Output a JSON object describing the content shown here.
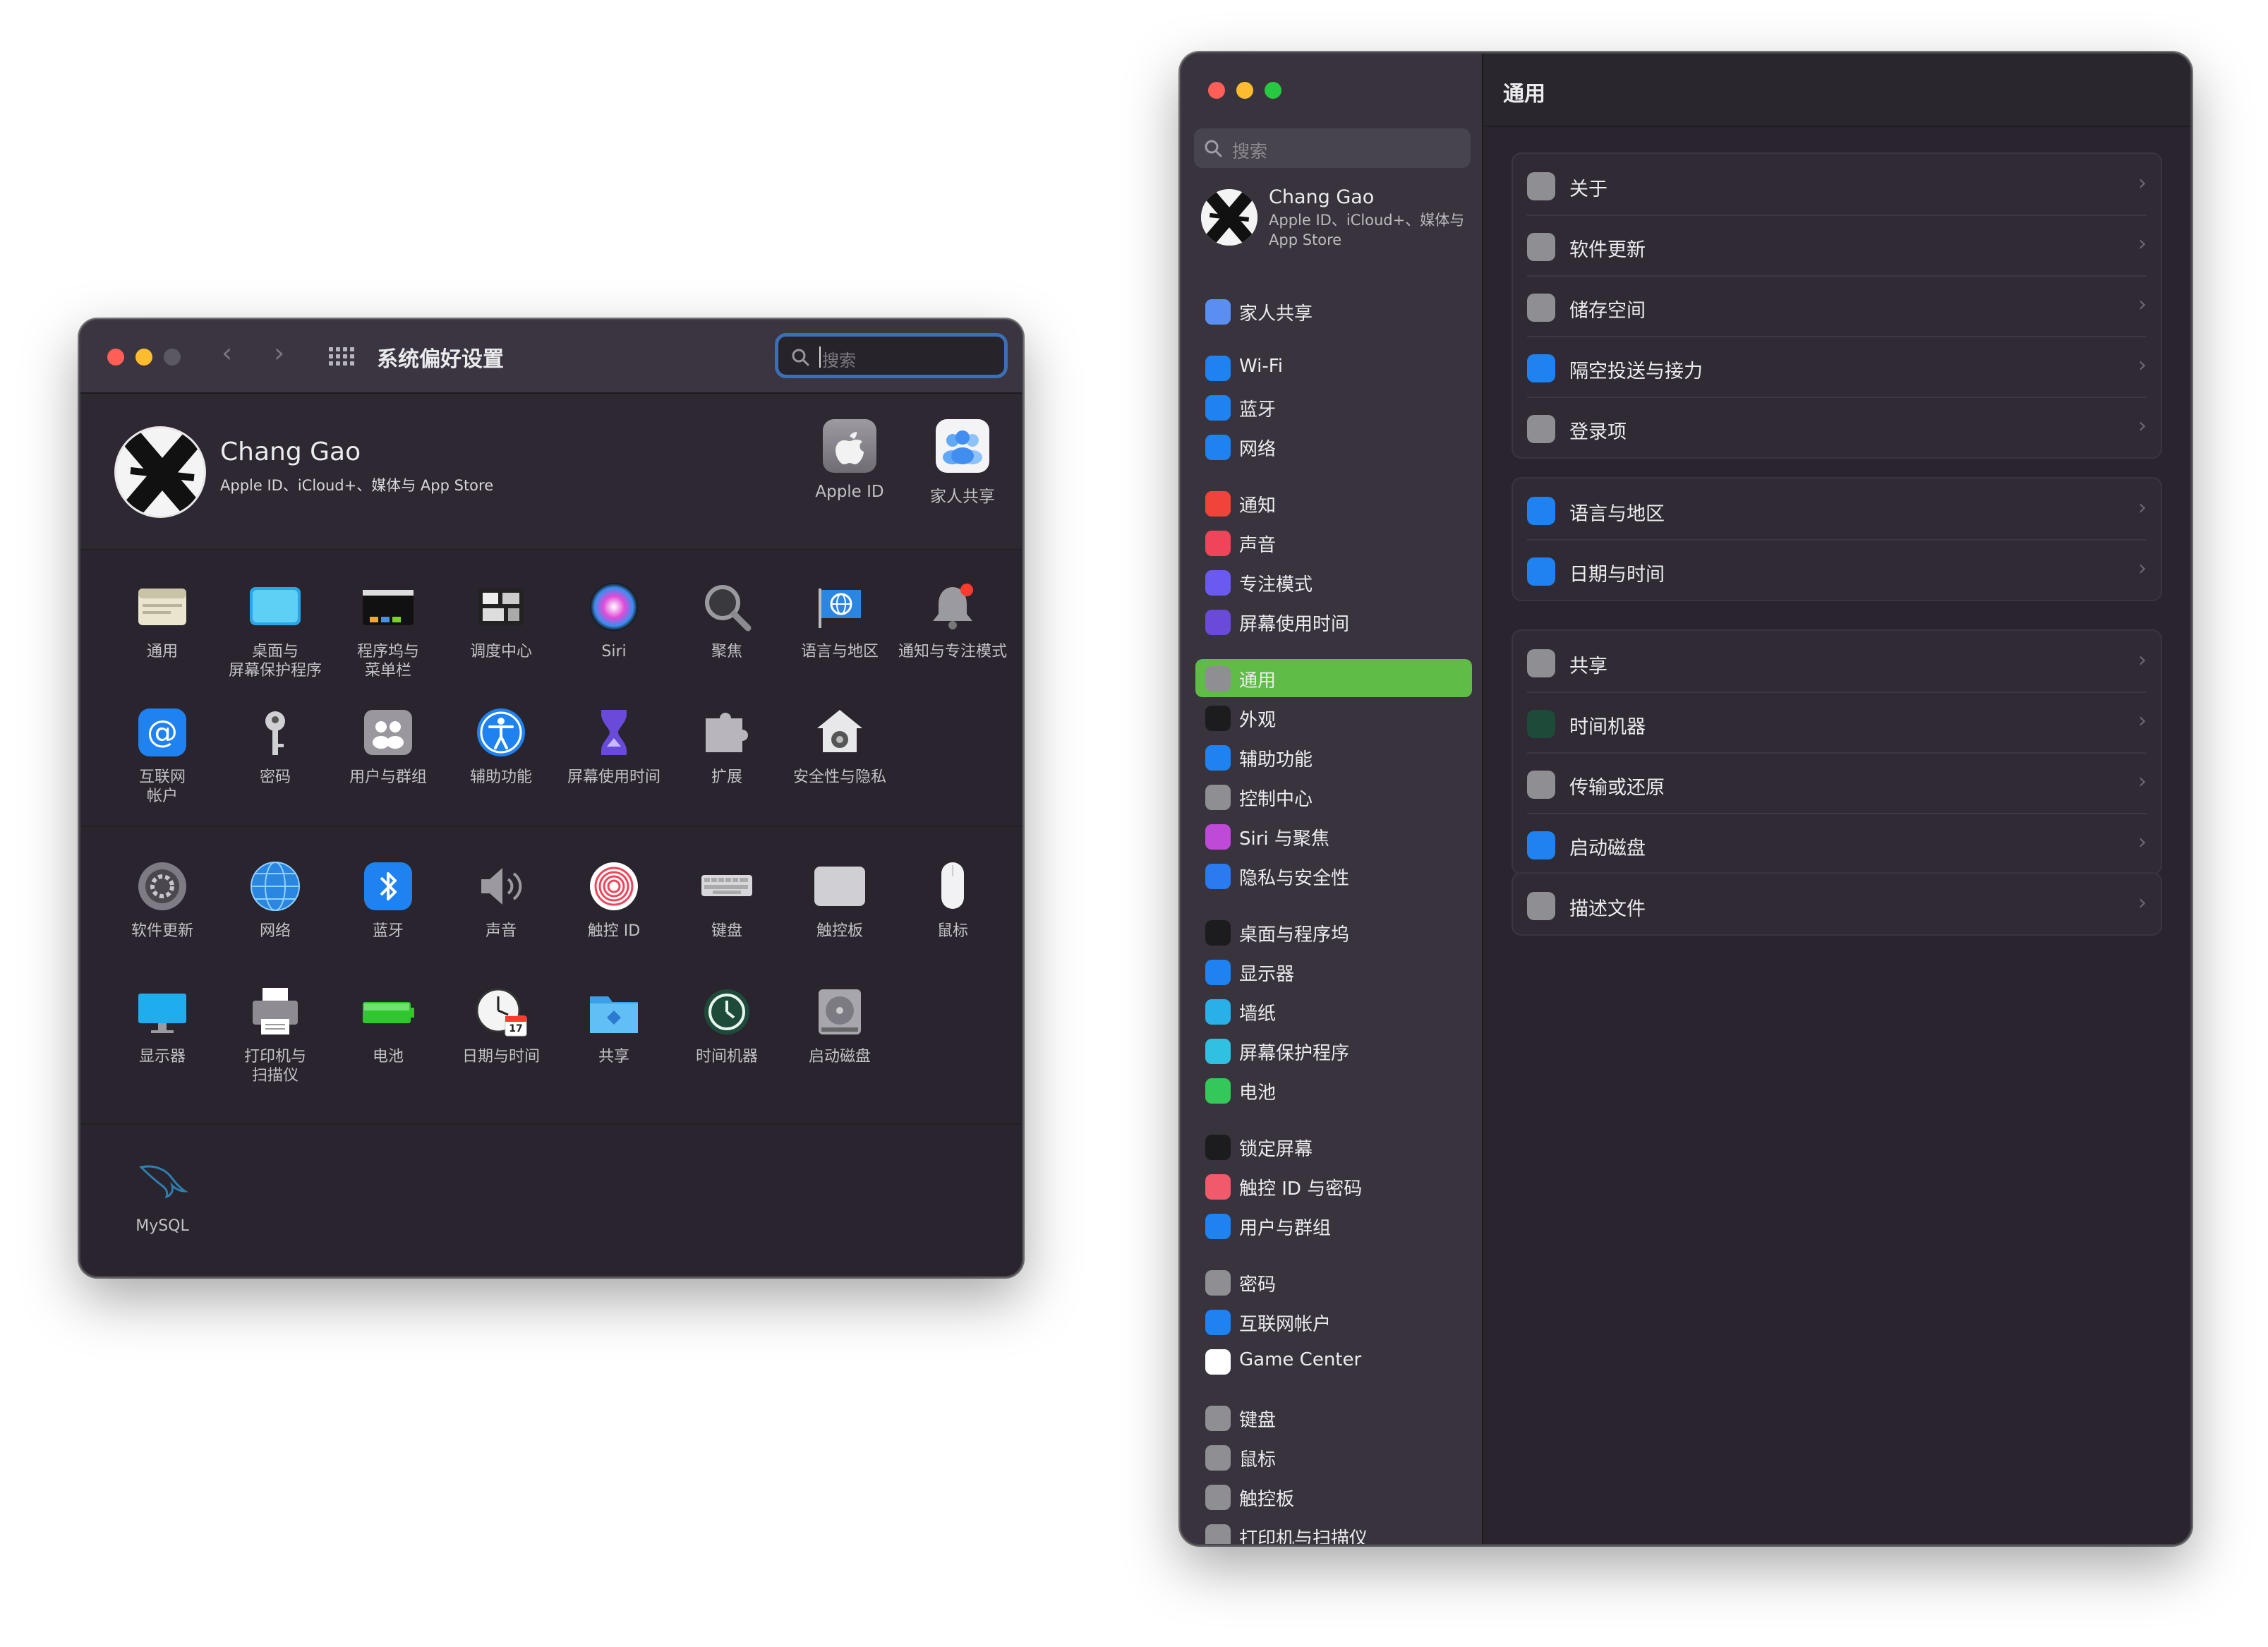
{
  "colors": {
    "accent_green": "#5fbc47",
    "search_focus_blue": "#3b6fb6",
    "traffic_red": "#ff5f57",
    "traffic_yellow": "#febc2e",
    "traffic_green": "#28c840",
    "window_bg": "#29242e"
  },
  "left_window": {
    "title": "系统偏好设置",
    "search": {
      "placeholder": "搜索"
    },
    "user": {
      "name": "Chang Gao",
      "subtitle": "Apple ID、iCloud+、媒体与 App Store"
    },
    "top_apps": [
      {
        "label": "Apple ID",
        "icon": "apple-id-icon"
      },
      {
        "label": "家人共享",
        "icon": "family-sharing-icon"
      }
    ],
    "section1": [
      {
        "label": "通用",
        "icon": "general-icon"
      },
      {
        "label": "桌面与\n屏幕保护程序",
        "icon": "desktop-screensaver-icon"
      },
      {
        "label": "程序坞与\n菜单栏",
        "icon": "dock-menubar-icon"
      },
      {
        "label": "调度中心",
        "icon": "mission-control-icon"
      },
      {
        "label": "Siri",
        "icon": "siri-icon"
      },
      {
        "label": "聚焦",
        "icon": "spotlight-icon"
      },
      {
        "label": "语言与地区",
        "icon": "language-region-icon"
      },
      {
        "label": "通知与专注模式",
        "icon": "notifications-focus-icon"
      },
      {
        "label": "互联网\n帐户",
        "icon": "internet-accounts-icon"
      },
      {
        "label": "密码",
        "icon": "passwords-icon"
      },
      {
        "label": "用户与群组",
        "icon": "users-groups-icon"
      },
      {
        "label": "辅助功能",
        "icon": "accessibility-icon"
      },
      {
        "label": "屏幕使用时间",
        "icon": "screen-time-icon"
      },
      {
        "label": "扩展",
        "icon": "extensions-icon"
      },
      {
        "label": "安全性与隐私",
        "icon": "security-privacy-icon"
      }
    ],
    "section2": [
      {
        "label": "软件更新",
        "icon": "software-update-icon"
      },
      {
        "label": "网络",
        "icon": "network-icon"
      },
      {
        "label": "蓝牙",
        "icon": "bluetooth-icon"
      },
      {
        "label": "声音",
        "icon": "sound-icon"
      },
      {
        "label": "触控 ID",
        "icon": "touch-id-icon"
      },
      {
        "label": "键盘",
        "icon": "keyboard-icon"
      },
      {
        "label": "触控板",
        "icon": "trackpad-icon"
      },
      {
        "label": "鼠标",
        "icon": "mouse-icon"
      },
      {
        "label": "显示器",
        "icon": "displays-icon"
      },
      {
        "label": "打印机与\n扫描仪",
        "icon": "printers-scanners-icon"
      },
      {
        "label": "电池",
        "icon": "battery-icon"
      },
      {
        "label": "日期与时间",
        "icon": "date-time-icon"
      },
      {
        "label": "共享",
        "icon": "sharing-icon"
      },
      {
        "label": "时间机器",
        "icon": "time-machine-icon"
      },
      {
        "label": "启动磁盘",
        "icon": "startup-disk-icon"
      }
    ],
    "section3": [
      {
        "label": "MySQL",
        "icon": "mysql-icon"
      }
    ],
    "calendar_day": "17"
  },
  "right_window": {
    "search": {
      "placeholder": "搜索"
    },
    "user": {
      "name": "Chang Gao",
      "subtitle": "Apple ID、iCloud+、媒体与 App Store"
    },
    "title": "通用",
    "sidebar": [
      {
        "label": "家人共享",
        "icon": "family-sharing-icon",
        "color": "#5a8ef0"
      },
      {
        "label": "Wi-Fi",
        "icon": "wifi-icon",
        "color": "#1e82f0"
      },
      {
        "label": "蓝牙",
        "icon": "bluetooth-icon",
        "color": "#1e82f0"
      },
      {
        "label": "网络",
        "icon": "network-icon",
        "color": "#1e82f0"
      },
      {
        "label": "通知",
        "icon": "notifications-icon",
        "color": "#f0443a"
      },
      {
        "label": "声音",
        "icon": "sound-icon",
        "color": "#f0445a"
      },
      {
        "label": "专注模式",
        "icon": "focus-icon",
        "color": "#6a5af0"
      },
      {
        "label": "屏幕使用时间",
        "icon": "screen-time-icon",
        "color": "#6a4ad8"
      },
      {
        "label": "通用",
        "icon": "general-icon",
        "color": "#8e8e93"
      },
      {
        "label": "外观",
        "icon": "appearance-icon",
        "color": "#1c1c1e"
      },
      {
        "label": "辅助功能",
        "icon": "accessibility-icon",
        "color": "#1e82f0"
      },
      {
        "label": "控制中心",
        "icon": "control-center-icon",
        "color": "#8e8e93"
      },
      {
        "label": "Siri 与聚焦",
        "icon": "siri-icon",
        "color": "#c04ad8"
      },
      {
        "label": "隐私与安全性",
        "icon": "privacy-security-icon",
        "color": "#2a7af0"
      },
      {
        "label": "桌面与程序坞",
        "icon": "desktop-dock-icon",
        "color": "#1c1c1e"
      },
      {
        "label": "显示器",
        "icon": "displays-icon",
        "color": "#1e82f0"
      },
      {
        "label": "墙纸",
        "icon": "wallpaper-icon",
        "color": "#2ab0e8"
      },
      {
        "label": "屏幕保护程序",
        "icon": "screensaver-icon",
        "color": "#30c0e0"
      },
      {
        "label": "电池",
        "icon": "battery-icon",
        "color": "#34c759"
      },
      {
        "label": "锁定屏幕",
        "icon": "lock-screen-icon",
        "color": "#1c1c1e"
      },
      {
        "label": "触控 ID 与密码",
        "icon": "touch-id-icon",
        "color": "#f05a6a"
      },
      {
        "label": "用户与群组",
        "icon": "users-groups-icon",
        "color": "#1e82f0"
      },
      {
        "label": "密码",
        "icon": "passwords-icon",
        "color": "#8e8e93"
      },
      {
        "label": "互联网帐户",
        "icon": "internet-accounts-icon",
        "color": "#1e82f0"
      },
      {
        "label": "Game Center",
        "icon": "game-center-icon",
        "color": "#ffffff"
      },
      {
        "label": "键盘",
        "icon": "keyboard-icon",
        "color": "#8e8e93"
      },
      {
        "label": "鼠标",
        "icon": "mouse-icon",
        "color": "#8e8e93"
      },
      {
        "label": "触控板",
        "icon": "trackpad-icon",
        "color": "#8e8e93"
      },
      {
        "label": "打印机与扫描仪",
        "icon": "printers-scanners-icon",
        "color": "#8e8e93"
      }
    ],
    "selected_sidebar_label": "通用",
    "groups": [
      [
        {
          "label": "关于",
          "icon": "about-icon"
        },
        {
          "label": "软件更新",
          "icon": "software-update-icon"
        },
        {
          "label": "储存空间",
          "icon": "storage-icon"
        },
        {
          "label": "隔空投送与接力",
          "icon": "airdrop-handoff-icon"
        },
        {
          "label": "登录项",
          "icon": "login-items-icon"
        }
      ],
      [
        {
          "label": "语言与地区",
          "icon": "language-region-icon"
        },
        {
          "label": "日期与时间",
          "icon": "date-time-icon"
        }
      ],
      [
        {
          "label": "共享",
          "icon": "sharing-icon"
        },
        {
          "label": "时间机器",
          "icon": "time-machine-icon"
        },
        {
          "label": "传输或还原",
          "icon": "transfer-reset-icon"
        },
        {
          "label": "启动磁盘",
          "icon": "startup-disk-icon"
        }
      ],
      [
        {
          "label": "描述文件",
          "icon": "profiles-icon"
        }
      ]
    ]
  }
}
